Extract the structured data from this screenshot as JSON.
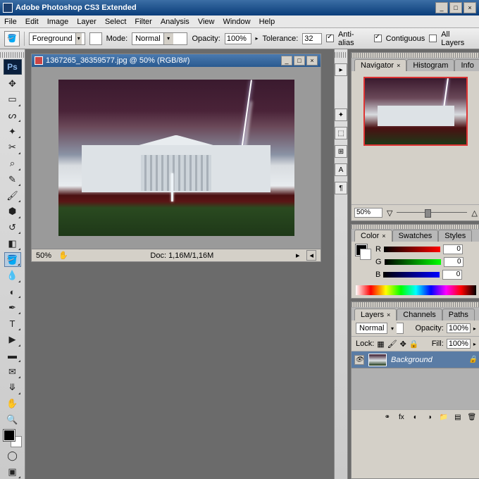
{
  "app": {
    "title": "Adobe Photoshop CS3 Extended",
    "logo": "Ps"
  },
  "menu": [
    "File",
    "Edit",
    "Image",
    "Layer",
    "Select",
    "Filter",
    "Analysis",
    "View",
    "Window",
    "Help"
  ],
  "options": {
    "fill_label": "Foreground",
    "mode_label": "Mode:",
    "mode_value": "Normal",
    "opacity_label": "Opacity:",
    "opacity_value": "100%",
    "tolerance_label": "Tolerance:",
    "tolerance_value": "32",
    "antialias_label": "Anti-alias",
    "contiguous_label": "Contiguous",
    "alllayers_label": "All Layers"
  },
  "doc": {
    "title": "1367265_36359577.jpg @ 50% (RGB/8#)",
    "status_zoom": "50%",
    "status_docsize": "Doc: 1,16M/1,16M"
  },
  "nav": {
    "tabs": [
      "Navigator",
      "Histogram",
      "Info"
    ],
    "zoom": "50%"
  },
  "color": {
    "tabs": [
      "Color",
      "Swatches",
      "Styles"
    ],
    "r_label": "R",
    "g_label": "G",
    "b_label": "B",
    "r": "0",
    "g": "0",
    "b": "0"
  },
  "layers": {
    "tabs": [
      "Layers",
      "Channels",
      "Paths"
    ],
    "blend": "Normal",
    "opacity_label": "Opacity:",
    "opacity": "100%",
    "lock_label": "Lock:",
    "fill_label": "Fill:",
    "fill": "100%",
    "layer_name": "Background"
  }
}
